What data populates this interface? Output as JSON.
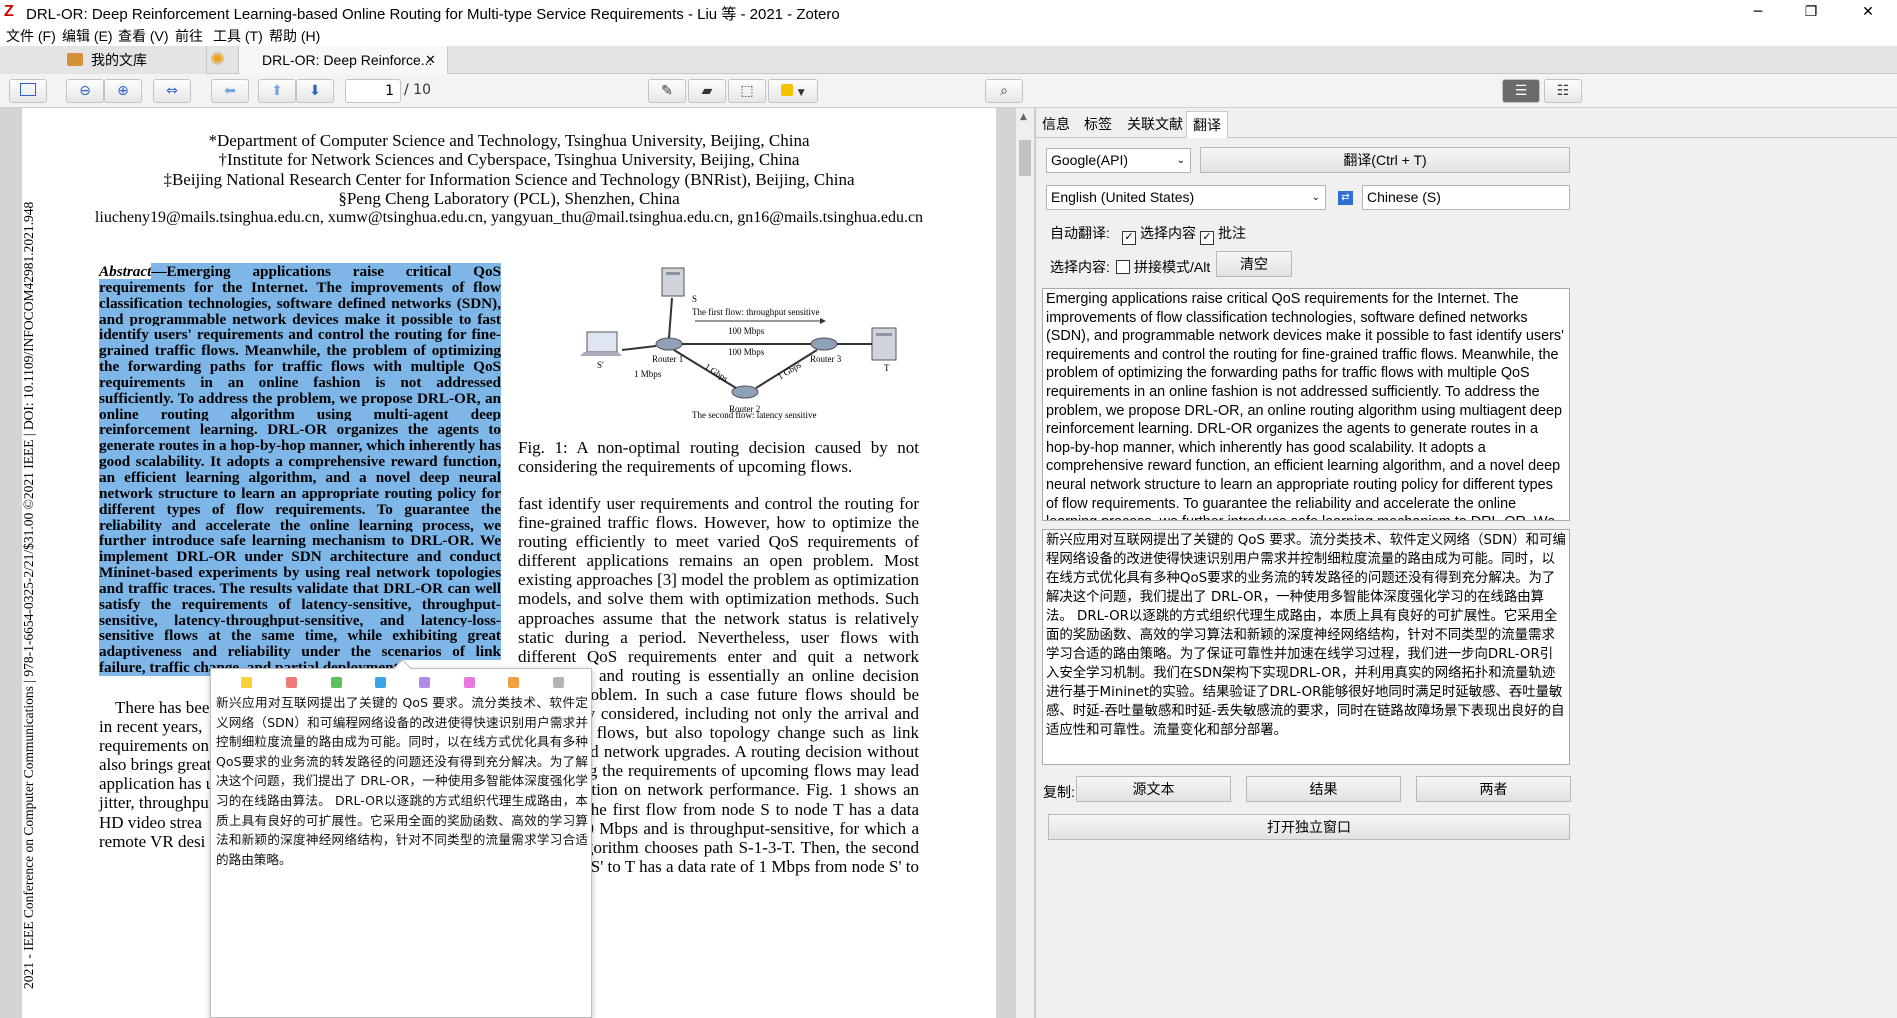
{
  "window": {
    "title": "DRL-OR: Deep Reinforcement Learning-based Online Routing for Multi-type Service Requirements - Liu 等 - 2021 - Zotero",
    "minimize": "─",
    "maximize": "❐",
    "close": "✕"
  },
  "menu": [
    "文件 (F)",
    "编辑 (E)",
    "查看 (V)",
    "前往",
    "工具 (T)",
    "帮助 (H)"
  ],
  "tabs": {
    "library": "我的文库",
    "active": "DRL-OR: Deep Reinforce...",
    "close": "✕"
  },
  "toolbar": {
    "page_current": "1",
    "page_total": "/ 10",
    "highlight_color": "#f5c400"
  },
  "document": {
    "affiliations": [
      "*Department of Computer Science and Technology, Tsinghua University, Beijing, China",
      "†Institute for Network Sciences and Cyberspace, Tsinghua University, Beijing, China",
      "‡Beijing National Research Center for Information Science and Technology (BNRist), Beijing, China",
      "§Peng Cheng Laboratory (PCL), Shenzhen, China",
      "liucheny19@mails.tsinghua.edu.cn, xumw@tsinghua.edu.cn, yangyuan_thu@mail.tsinghua.edu.cn, gn16@mails.tsinghua.edu.cn"
    ],
    "side_text": "2021 - IEEE Conference on Computer Communications | 978-1-6654-0325-2/21/$31.00 ©2021 IEEE | DOI: 10.1109/INFOCOM42981.2021.948",
    "abstract_label": "Abstract",
    "abstract_text": "—Emerging applications raise critical QoS requirements for the Internet. The improvements of flow classification technologies, software defined networks (SDN), and programmable network devices make it possible to fast identify users' requirements and control the routing for fine-grained traffic flows. Meanwhile, the problem of optimizing the forwarding paths for traffic flows with multiple QoS requirements in an online fashion is not addressed sufficiently. To address the problem, we propose DRL-OR, an online routing algorithm using multi-agent deep reinforcement learning. DRL-OR organizes the agents to generate routes in a hop-by-hop manner, which inherently has good scalability. It adopts a comprehensive reward function, an efficient learning algorithm, and a novel deep neural network structure to learn an appropriate routing policy for different types of flow requirements. To guarantee the reliability and accelerate the online learning process, we further introduce safe learning mechanism to DRL-OR. We implement DRL-OR under SDN architecture and conduct Mininet-based experiments by using real network topologies and traffic traces. The results validate that DRL-OR can well satisfy the requirements of latency-sensitive, throughput-sensitive, latency-throughput-sensitive, and latency-loss-sensitive flows at the same time, while exhibiting great adaptiveness and reliability under the scenarios of link failure, traffic change, and partial deployment.",
    "figure": {
      "node_s": "S",
      "node_s2": "S'",
      "node_t": "T",
      "router1": "Router 1",
      "router2": "Router 2",
      "router3": "Router 3",
      "first_flow": "The first flow: throughput sensitive",
      "second_flow": "The second flow: latency sensitive",
      "bw_100a": "100 Mbps",
      "bw_100b": "100 Mbps",
      "bw_1g_a": "1 Gbps",
      "bw_1g_b": "1 Gbps",
      "bw_1m": "1 Mbps",
      "caption": "Fig. 1: A non-optimal routing decision caused by not considering the requirements of upcoming flows."
    },
    "right_col": "fast identify user requirements and control the routing for fine-grained traffic flows. However, how to optimize the routing efficiently to meet varied QoS requirements of different applications remains an open problem. Most existing approaches [3] model the problem as optimization models, and solve them with optimization methods. Such approaches assume that the network status is relatively static during a period. Nevertheless, user flows with different QoS requirements enter and quit a network frequently, and routing is essentially an online decision making problem. In such a case future flows should be sufficiently considered, including not only the arrival and leaving of flows, but also topology change such as link failures and network upgrades. A routing decision without considering the requirements of upcoming flows may lead to degradation on network performance. Fig. 1 shows an example: the first flow from node S to node T has a data rate of 100 Mbps and is throughput-sensitive, for which a routing algorithm chooses path S-1-3-T. Then, the second flow from S' to T has a data rate of 1 Mbps from node S' to T,",
    "left_col2": [
      "There has bee",
      "in recent years,",
      "requirements on",
      "also brings great",
      "application has u",
      "jitter, throughpu",
      "HD video strea",
      "remote VR desi"
    ]
  },
  "popup": {
    "colors": [
      "#f5d23a",
      "#f07a7a",
      "#5cc05c",
      "#3aa6e6",
      "#b08ae6",
      "#e67ae0",
      "#f0a040",
      "#b4b4b4"
    ],
    "text": "新兴应用对互联网提出了关键的 QoS 要求。流分类技术、软件定义网络（SDN）和可编程网络设备的改进使得快速识别用户需求并控制细粒度流量的路由成为可能。同时，以在线方式优化具有多种QoS要求的业务流的转发路径的问题还没有得到充分解决。为了解决这个问题，我们提出了 DRL-OR，一种使用多智能体深度强化学习的在线路由算法。 DRL-OR以逐跳的方式组织代理生成路由，本质上具有良好的可扩展性。它采用全面的奖励函数、高效的学习算法和新颖的深度神经网络结构，针对不同类型的流量需求学习合适的路由策略。"
  },
  "panel": {
    "tabs": [
      "信息",
      "标签",
      "关联文献",
      "翻译"
    ],
    "engine": "Google(API)",
    "translate_button": "翻译(Ctrl + T)",
    "source_lang": "English (United States)",
    "target_lang": "Chinese (S)",
    "auto_translate_label": "自动翻译:",
    "opt_selection": "选择内容",
    "opt_annotation": "批注",
    "selection_label": "选择内容:",
    "concat_mode": "拼接模式/Alt",
    "clear_button": "清空",
    "source_text": "Emerging applications raise critical QoS requirements for the Internet. The improvements of flow classification technologies, software defined networks (SDN), and programmable network devices make it possible to fast identify users' requirements and control the routing for fine-grained traffic flows. Meanwhile, the problem of optimizing the forwarding paths for traffic flows with multiple QoS requirements in an online fashion is not addressed sufficiently. To address the problem, we propose DRL-OR, an online routing algorithm using multiagent deep reinforcement learning. DRL-OR organizes the agents to generate routes in a hop-by-hop manner, which inherently has good scalability. It adopts a comprehensive reward function, an efficient learning algorithm, and a novel deep neural network structure to learn an appropriate routing policy for different types of flow requirements. To guarantee the reliability and accelerate the online learning process, we further introduce safe learning mechanism to DRL-OR. We implement DRL-OR under SDN",
    "result_text": "新兴应用对互联网提出了关键的 QoS 要求。流分类技术、软件定义网络（SDN）和可编程网络设备的改进使得快速识别用户需求并控制细粒度流量的路由成为可能。同时，以在线方式优化具有多种QoS要求的业务流的转发路径的问题还没有得到充分解决。为了解决这个问题，我们提出了 DRL-OR，一种使用多智能体深度强化学习的在线路由算法。 DRL-OR以逐跳的方式组织代理生成路由，本质上具有良好的可扩展性。它采用全面的奖励函数、高效的学习算法和新颖的深度神经网络结构，针对不同类型的流量需求学习合适的路由策略。为了保证可靠性并加速在线学习过程，我们进一步向DRL-OR引入安全学习机制。我们在SDN架构下实现DRL-OR，并利用真实的网络拓扑和流量轨迹进行基于Mininet的实验。结果验证了DRL-OR能够很好地同时满足时延敏感、吞吐量敏感、时延-吞吐量敏感和时延-丢失敏感流的要求，同时在链路故障场景下表现出良好的自适应性和可靠性。流量变化和部分部署。",
    "copy_label": "复制:",
    "copy_source": "源文本",
    "copy_result": "结果",
    "copy_both": "两者",
    "open_window": "打开独立窗口"
  }
}
